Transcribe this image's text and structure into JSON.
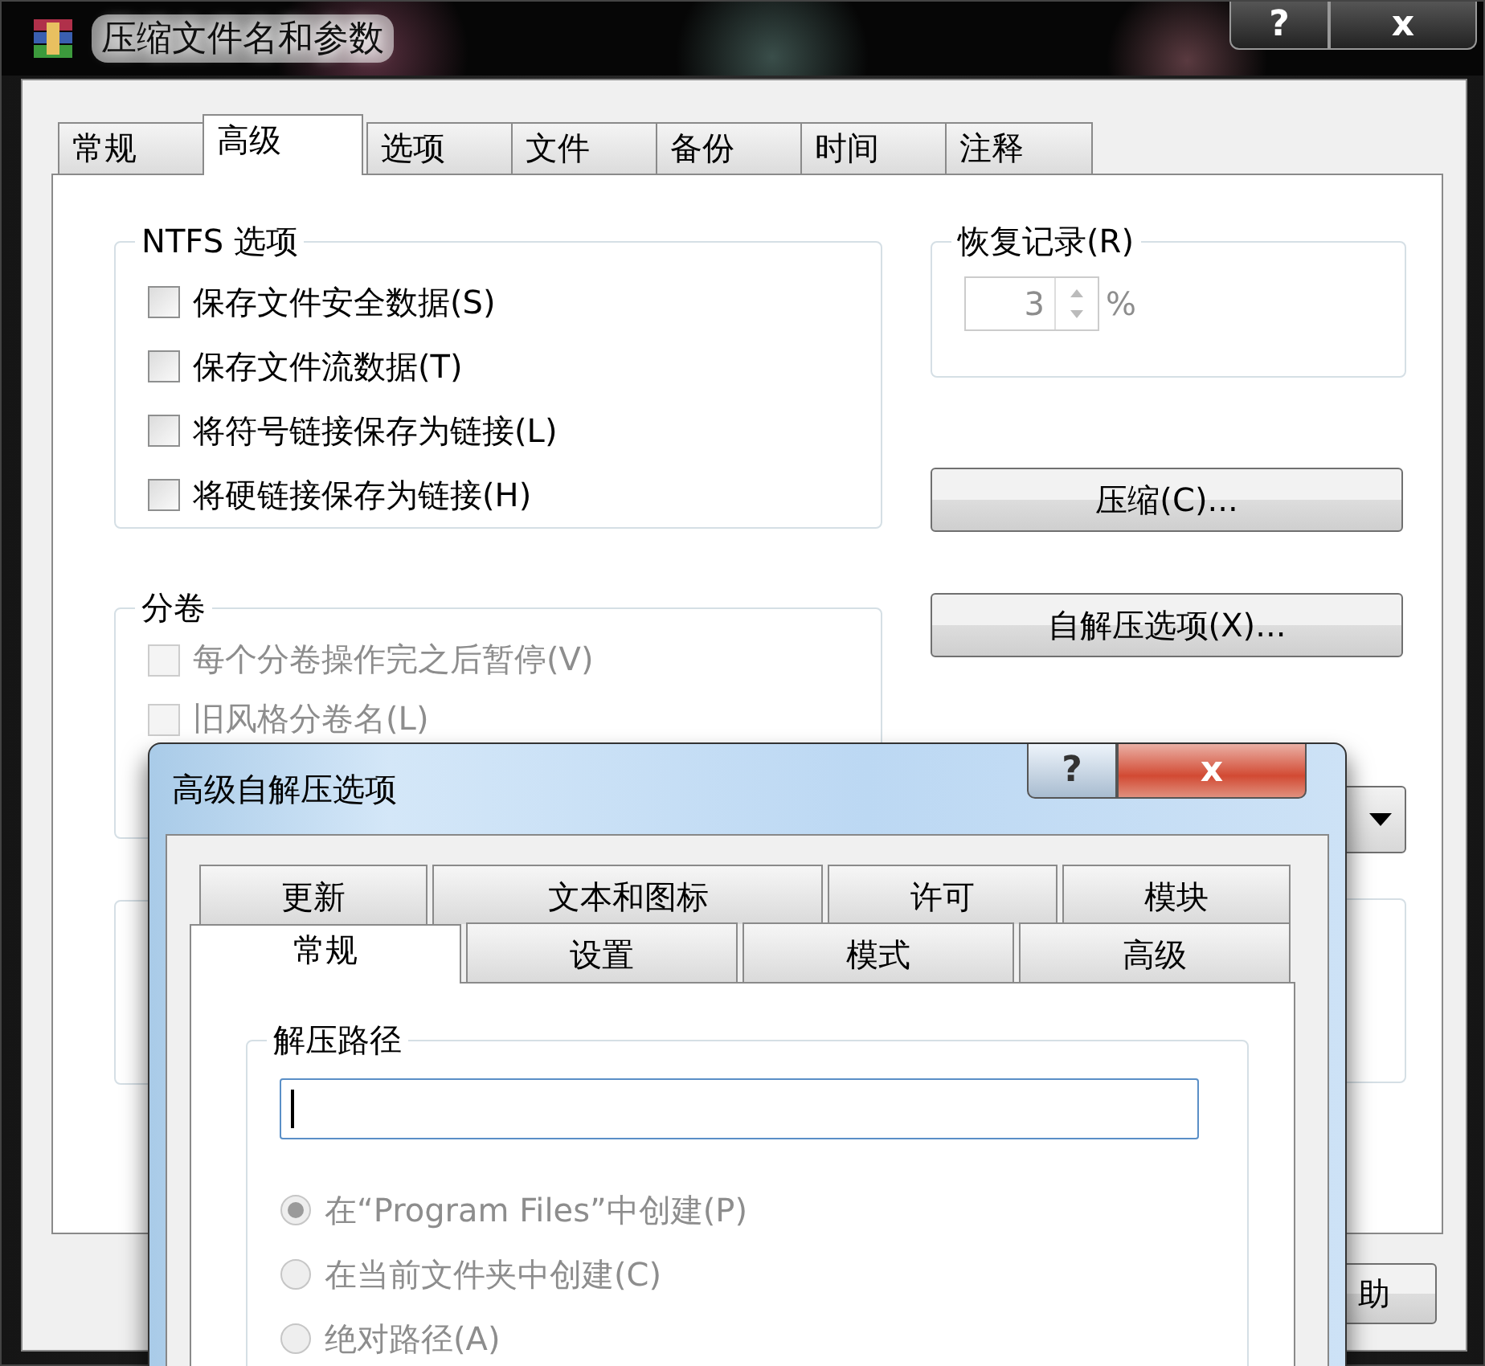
{
  "window": {
    "title": "压缩文件名和参数",
    "help": "?",
    "close": "x"
  },
  "tabs": [
    {
      "label": "常规",
      "selected": false
    },
    {
      "label": "高级",
      "selected": true
    },
    {
      "label": "选项",
      "selected": false
    },
    {
      "label": "文件",
      "selected": false
    },
    {
      "label": "备份",
      "selected": false
    },
    {
      "label": "时间",
      "selected": false
    },
    {
      "label": "注释",
      "selected": false
    }
  ],
  "ntfs": {
    "title": "NTFS 选项",
    "options": [
      {
        "label": "保存文件安全数据(S)",
        "checked": false,
        "disabled": false
      },
      {
        "label": "保存文件流数据(T)",
        "checked": false,
        "disabled": false
      },
      {
        "label": "将符号链接保存为链接(L)",
        "checked": false,
        "disabled": false
      },
      {
        "label": "将硬链接保存为链接(H)",
        "checked": false,
        "disabled": false
      }
    ]
  },
  "recovery": {
    "title": "恢复记录(R)",
    "value": "3",
    "unit": "%",
    "disabled": true
  },
  "buttons": [
    {
      "label": "压缩(C)..."
    },
    {
      "label": "自解压选项(X)..."
    }
  ],
  "volumes": {
    "title": "分卷",
    "options": [
      {
        "label": "每个分卷操作完之后暂停(V)",
        "checked": false,
        "disabled": true
      },
      {
        "label": "旧风格分卷名(L)",
        "checked": false,
        "disabled": true
      }
    ]
  },
  "bottom_button": {
    "label": "助"
  },
  "sfx_dialog": {
    "title": "高级自解压选项",
    "help": "?",
    "close": "x",
    "tab_rows": [
      [
        {
          "label": "更新",
          "selected": false
        },
        {
          "label": "文本和图标",
          "selected": false
        },
        {
          "label": "许可",
          "selected": false
        },
        {
          "label": "模块",
          "selected": false
        }
      ],
      [
        {
          "label": "常规",
          "selected": true
        },
        {
          "label": "设置",
          "selected": false
        },
        {
          "label": "模式",
          "selected": false
        },
        {
          "label": "高级",
          "selected": false
        }
      ]
    ],
    "path_group": {
      "title": "解压路径",
      "focused": true
    },
    "radios": [
      {
        "label": "在“Program Files”中创建(P)",
        "selected": true,
        "disabled": true
      },
      {
        "label": "在当前文件夹中创建(C)",
        "selected": false,
        "disabled": true
      },
      {
        "label": "绝对路径(A)",
        "selected": false,
        "disabled": true
      }
    ]
  }
}
